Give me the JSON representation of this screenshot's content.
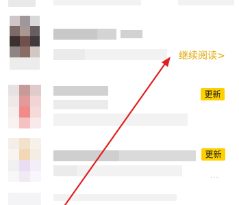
{
  "list": {
    "items": [
      {
        "action_label": "继续阅读>"
      },
      {
        "badge_label": "更新"
      },
      {
        "badge_label": "更新",
        "more_label": "···"
      }
    ]
  },
  "colors": {
    "accent": "#e0a800",
    "badge_bg": "#ffd000",
    "arrow": "#e02020"
  },
  "icons": {
    "annotation": "red-arrow-icon",
    "more": "more-dots-icon"
  }
}
